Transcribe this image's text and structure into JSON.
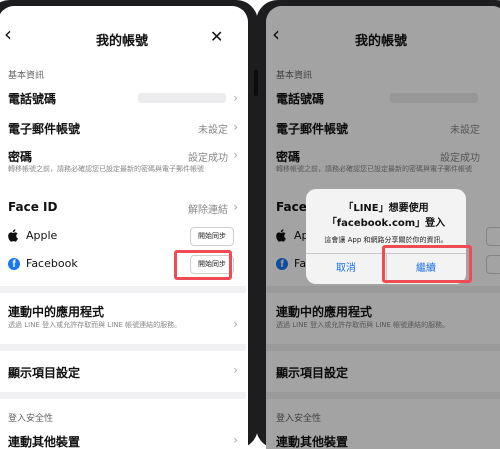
{
  "left_screen": {
    "header": {
      "title": "我的帳號",
      "back_icon": "chevron-left-icon",
      "close_icon": "close-icon"
    },
    "basic_info_section": "基本資訊",
    "phone_label": "電話號碼",
    "email_label": "電子郵件帳號",
    "email_value": "未設定",
    "password_label": "密碼",
    "password_value": "設定成功",
    "password_note": "轉移帳號之前，請務必確認您已設定最新的密碼與電子郵件帳號",
    "faceid_label": "Face ID",
    "faceid_value": "解除連結",
    "apple_label": "Apple",
    "apple_sync": "開始同步",
    "facebook_label": "Facebook",
    "facebook_sync": "開始同步",
    "connected_apps_label": "連動中的應用程式",
    "connected_apps_note": "透過 LINE 登入或允許存取而與 LINE 帳號連結的服務。",
    "display_settings_label": "顯示項目設定",
    "login_security_section": "登入安全性",
    "link_devices_label": "連動其他裝置",
    "highlight_color": "#f04b55"
  },
  "right_screen": {
    "header": {
      "title": "我的帳號"
    },
    "basic_info_section": "基本資訊",
    "phone_label": "電話號碼",
    "email_label": "電子郵件帳號",
    "email_value": "未設定",
    "password_label": "密碼",
    "password_value": "設定成功",
    "password_note": "轉移帳號之前，請務必確認您已設定最新的密碼與電子郵件帳號",
    "faceid_label": "Face",
    "apple_label": "Ap",
    "facebook_label": "Fa",
    "connected_apps_label": "連動中的應用程式",
    "connected_apps_note": "透過 LINE 登入或允許存取而與 LINE 帳號連結的服務。",
    "display_settings_label": "顯示項目設定",
    "login_security_section": "登入安全性",
    "link_devices_label": "連動其他裝置",
    "dialog": {
      "title_line1": "「LINE」想要使用",
      "title_line2": "「facebook.com」登入",
      "message": "這會讓 App 和網路分享關於你的資訊。",
      "cancel_label": "取消",
      "continue_label": "繼續"
    },
    "link_color": "#1a72e8"
  }
}
